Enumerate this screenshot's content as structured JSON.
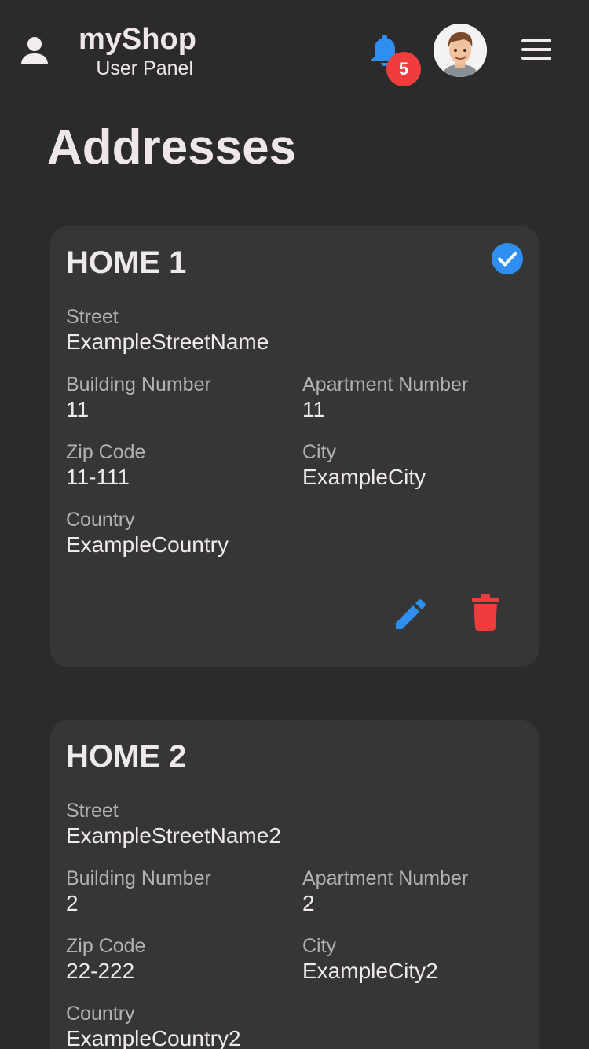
{
  "header": {
    "brand_title": "myShop",
    "brand_subtitle": "User Panel",
    "notification_count": "5",
    "icons": {
      "user": "user-icon",
      "bell": "bell-icon",
      "menu": "hamburger-menu-icon",
      "avatar": "avatar"
    }
  },
  "page": {
    "title": "Addresses"
  },
  "labels": {
    "street": "Street",
    "building_number": "Building Number",
    "apartment_number": "Apartment Number",
    "zip_code": "Zip Code",
    "city": "City",
    "country": "Country"
  },
  "addresses": [
    {
      "name": "HOME 1",
      "selected": true,
      "street": "ExampleStreetName",
      "building_number": "11",
      "apartment_number": "11",
      "zip_code": "11-111",
      "city": "ExampleCity",
      "country": "ExampleCountry"
    },
    {
      "name": "HOME 2",
      "selected": false,
      "street": "ExampleStreetName2",
      "building_number": "2",
      "apartment_number": "2",
      "zip_code": "22-222",
      "city": "ExampleCity2",
      "country": "ExampleCountry2"
    }
  ],
  "colors": {
    "background": "#2b2b2b",
    "card": "#363636",
    "accent_blue": "#2e8ff0",
    "danger_red": "#ef3d3d",
    "label_gray": "#b5b1b1"
  }
}
